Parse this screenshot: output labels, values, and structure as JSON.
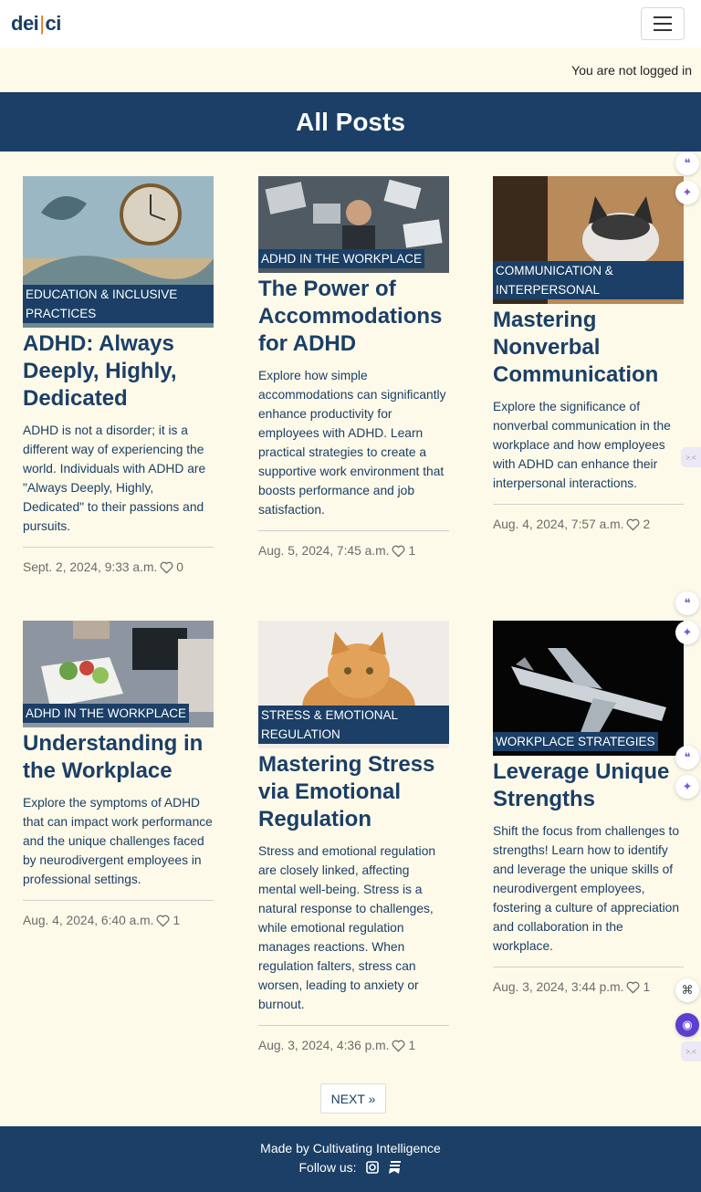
{
  "nav": {
    "brand_left": "dei",
    "brand_sep": "|",
    "brand_right": "ci"
  },
  "login_status": "You are not logged in",
  "page_title": "All Posts",
  "posts": [
    {
      "category": "EDUCATION & INCLUSIVE PRACTICES",
      "title": "ADHD: Always Deeply, Highly, Dedicated",
      "excerpt": "ADHD is not a disorder; it is a different way of experiencing the world. Individuals with ADHD are \"Always Deeply, Highly, Dedicated\" to their passions and pursuits.",
      "date": "Sept. 2, 2024, 9:33 a.m.",
      "likes": "0"
    },
    {
      "category": "ADHD IN THE WORKPLACE",
      "title": "The Power of Accommodations for ADHD",
      "excerpt": "Explore how simple accommodations can significantly enhance productivity for employees with ADHD. Learn practical strategies to create a supportive work environment that boosts performance and job satisfaction.",
      "date": "Aug. 5, 2024, 7:45 a.m.",
      "likes": "1"
    },
    {
      "category": "COMMUNICATION & INTERPERSONAL",
      "title": "Mastering Nonverbal Communication",
      "excerpt": "Explore the significance of nonverbal communication in the workplace and how employees with ADHD can enhance their interpersonal interactions.",
      "date": "Aug. 4, 2024, 7:57 a.m.",
      "likes": "2"
    },
    {
      "category": "ADHD IN THE WORKPLACE",
      "title": "Understanding in the Workplace",
      "excerpt": "Explore the symptoms of ADHD that can impact work performance and the unique challenges faced by neurodivergent employees in professional settings.",
      "date": "Aug. 4, 2024, 6:40 a.m.",
      "likes": "1"
    },
    {
      "category": "STRESS & EMOTIONAL REGULATION",
      "title": "Mastering Stress via Emotional Regulation",
      "excerpt": "Stress and emotional regulation are closely linked, affecting mental well-being. Stress is a natural response to challenges, while emotional regulation manages reactions. When regulation falters, stress can worsen, leading to anxiety or burnout.",
      "date": "Aug. 3, 2024, 4:36 p.m.",
      "likes": "1"
    },
    {
      "category": "WORKPLACE STRATEGIES",
      "title": "Leverage Unique Strengths",
      "excerpt": "Shift the focus from challenges to strengths! Learn how to identify and leverage the unique skills of neurodivergent employees, fostering a culture of appreciation and collaboration in the workplace.",
      "date": "Aug. 3, 2024, 3:44 p.m.",
      "likes": "1"
    }
  ],
  "pagination": {
    "next_label": "NEXT »"
  },
  "footer": {
    "made_by": "Made by Cultivating Intelligence",
    "follow_label": "Follow us:"
  },
  "colors": {
    "primary": "#1b3f66",
    "background": "#fefae9",
    "accent": "#e07a1f"
  },
  "icons": [
    "menu-icon",
    "heart-icon",
    "instagram-icon",
    "substack-icon",
    "quote-icon",
    "sparkle-icon",
    "command-icon",
    "assistant-icon"
  ]
}
